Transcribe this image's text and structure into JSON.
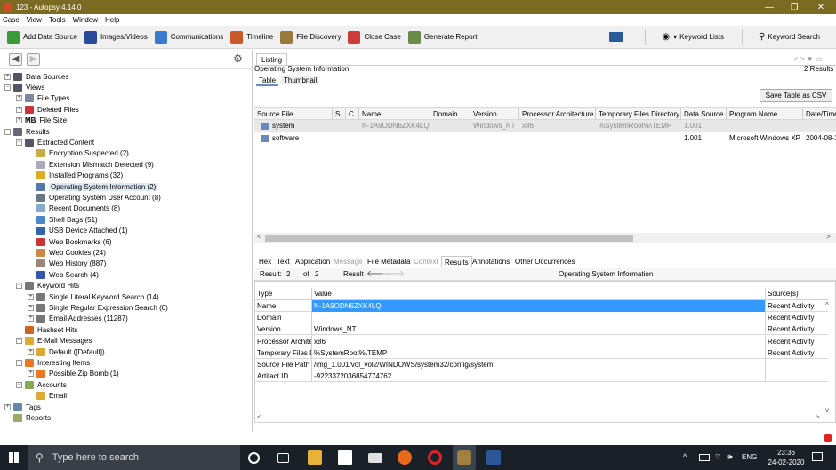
{
  "window": {
    "title": "123 - Autopsy 4.14.0",
    "minimize": "—",
    "maximize": "❐",
    "close": "✕"
  },
  "menu": [
    "Case",
    "View",
    "Tools",
    "Window",
    "Help"
  ],
  "toolbar": {
    "items": [
      {
        "label": "Add Data Source",
        "color": "#3a9a3a"
      },
      {
        "label": "Images/Videos",
        "color": "#2a4a9a"
      },
      {
        "label": "Communications",
        "color": "#3a7acc"
      },
      {
        "label": "Timeline",
        "color": "#c85a2a"
      },
      {
        "label": "File Discovery",
        "color": "#9a7a3a"
      },
      {
        "label": "Close Case",
        "color": "#cc3a3a"
      },
      {
        "label": "Generate Report",
        "color": "#6a8a4a"
      }
    ],
    "keyword_lists": "Keyword Lists",
    "keyword_search": "Keyword Search"
  },
  "tree": [
    {
      "label": "Data Sources",
      "level": 0,
      "exp": "+",
      "color": "#556"
    },
    {
      "label": "Views",
      "level": 0,
      "exp": "−",
      "color": "#556"
    },
    {
      "label": "File Types",
      "level": 1,
      "exp": "+",
      "color": "#7a8a9a"
    },
    {
      "label": "Deleted Files",
      "level": 1,
      "exp": "+",
      "color": "#cc3333"
    },
    {
      "label": "File Size",
      "level": 1,
      "exp": "+",
      "icontext": "MB"
    },
    {
      "label": "Results",
      "level": 0,
      "exp": "−",
      "color": "#667"
    },
    {
      "label": "Extracted Content",
      "level": 1,
      "exp": "−",
      "color": "#556"
    },
    {
      "label": "Encryption Suspected (2)",
      "level": 2,
      "color": "#ccaa44"
    },
    {
      "label": "Extension Mismatch Detected (9)",
      "level": 2,
      "color": "#aab"
    },
    {
      "label": "Installed Programs (32)",
      "level": 2,
      "color": "#ddaa22"
    },
    {
      "label": "Operating System Information (2)",
      "level": 2,
      "color": "#5577aa",
      "selected": true
    },
    {
      "label": "Operating System User Account (8)",
      "level": 2,
      "color": "#667788"
    },
    {
      "label": "Recent Documents (8)",
      "level": 2,
      "color": "#88aacc"
    },
    {
      "label": "Shell Bags (51)",
      "level": 2,
      "color": "#4a88cc"
    },
    {
      "label": "USB Device Attached (1)",
      "level": 2,
      "color": "#3366aa"
    },
    {
      "label": "Web Bookmarks (6)",
      "level": 2,
      "color": "#cc3333"
    },
    {
      "label": "Web Cookies (24)",
      "level": 2,
      "color": "#cc8844"
    },
    {
      "label": "Web History (887)",
      "level": 2,
      "color": "#998877"
    },
    {
      "label": "Web Search (4)",
      "level": 2,
      "color": "#3355aa"
    },
    {
      "label": "Keyword Hits",
      "level": 1,
      "exp": "−",
      "color": "#777"
    },
    {
      "label": "Single Literal Keyword Search (14)",
      "level": 2,
      "exp": "+",
      "color": "#777"
    },
    {
      "label": "Single Regular Expression Search (0)",
      "level": 2,
      "exp": "+",
      "color": "#777"
    },
    {
      "label": "Email Addresses (11287)",
      "level": 2,
      "exp": "+",
      "color": "#777"
    },
    {
      "label": "Hashset Hits",
      "level": 1,
      "color": "#cc6622"
    },
    {
      "label": "E-Mail Messages",
      "level": 1,
      "exp": "−",
      "color": "#ddaa33"
    },
    {
      "label": "Default ([Default])",
      "level": 2,
      "exp": "+",
      "color": "#ddaa33"
    },
    {
      "label": "Interesting Items",
      "level": 1,
      "exp": "−",
      "color": "#ee7722"
    },
    {
      "label": "Possible Zip Bomb (1)",
      "level": 2,
      "exp": "+",
      "color": "#ee7722"
    },
    {
      "label": "Accounts",
      "level": 1,
      "exp": "−",
      "color": "#88aa55"
    },
    {
      "label": "Email",
      "level": 2,
      "color": "#ddaa33"
    },
    {
      "label": "Tags",
      "level": 0,
      "exp": "+",
      "color": "#6688aa"
    },
    {
      "label": "Reports",
      "level": 0,
      "color": "#99aa66"
    }
  ],
  "listing": {
    "tab": "Listing",
    "subtitle": "Operating System Information",
    "results_count": "2 Results",
    "view_tabs": [
      "Table",
      "Thumbnail"
    ],
    "save_csv": "Save Table as CSV",
    "columns": [
      "Source File",
      "S",
      "C",
      "Name",
      "Domain",
      "Version",
      "Processor Architecture",
      "Temporary Files Directory",
      "Data Source",
      "Program Name",
      "Date/Time"
    ],
    "rows": [
      [
        "system",
        "",
        "",
        "N-1A9ODN6ZXK4LQ",
        "",
        "Windows_NT",
        "x86",
        "%SystemRoot%\\TEMP",
        "1.001",
        "",
        ""
      ],
      [
        "software",
        "",
        "",
        "",
        "",
        "",
        "",
        "",
        "1.001",
        "Microsoft Windows XP",
        "2004-08-1"
      ]
    ]
  },
  "detail": {
    "tabs": [
      "Hex",
      "Text",
      "Application",
      "Message",
      "File Metadata",
      "Context",
      "Results",
      "Annotations",
      "Other Occurrences"
    ],
    "result_label": "Result:",
    "result_num": "2",
    "of_label": "of",
    "total": "2",
    "result_word": "Result",
    "title": "Operating System Information",
    "columns": [
      "Type",
      "Value",
      "Source(s)"
    ],
    "rows": [
      {
        "type": "Name",
        "value": "N-1A9ODN6ZXK4LQ",
        "source": "Recent Activity"
      },
      {
        "type": "Domain",
        "value": "",
        "source": "Recent Activity"
      },
      {
        "type": "Version",
        "value": "Windows_NT",
        "source": "Recent Activity"
      },
      {
        "type": "Processor Architec",
        "value": "x86",
        "source": "Recent Activity"
      },
      {
        "type": "Temporary Files Di",
        "value": "%SystemRoot%\\TEMP",
        "source": "Recent Activity"
      },
      {
        "type": "Source File Path",
        "value": "/img_1.001/vol_vol2/WINDOWS/system32/config/system",
        "source": ""
      },
      {
        "type": "Artifact ID",
        "value": "-9223372036854774762",
        "source": ""
      }
    ]
  },
  "taskbar": {
    "search_placeholder": "Type here to search",
    "lang": "ENG",
    "time": "23:36",
    "date": "24-02-2020"
  }
}
